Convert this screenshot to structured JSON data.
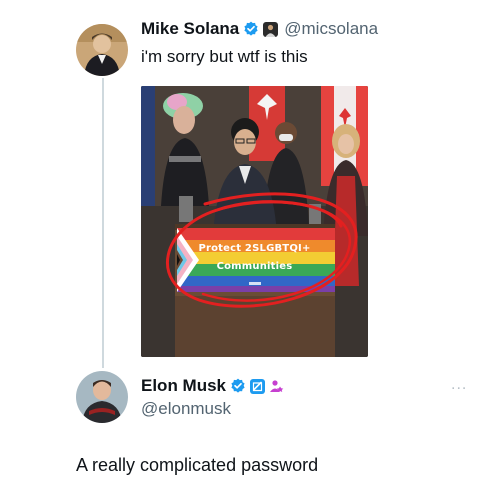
{
  "tweet1": {
    "display_name": "Mike Solana",
    "handle": "@micsolana",
    "text": "i'm sorry but wtf is this",
    "avatar_icon": "profile-photo-portrait-painting",
    "badges": [
      "verified-badge-icon",
      "affiliate-badge-icon"
    ]
  },
  "media": {
    "banner_line1": "Protect 2SLGBTQI+",
    "banner_line2": "Communities",
    "annotation": "red-hand-drawn-circle"
  },
  "tweet2": {
    "display_name": "Elon Musk",
    "handle": "@elonmusk",
    "text": "A really complicated password",
    "avatar_icon": "profile-photo",
    "badges": [
      "verified-badge-icon",
      "government-square-badge-icon",
      "affiliate-people-icon"
    ]
  },
  "more_label": "...",
  "colors": {
    "verified_blue": "#1d9bf0",
    "thread_line": "#cfd9de",
    "secondary_text": "#536471",
    "annotation_red": "#e32020"
  }
}
